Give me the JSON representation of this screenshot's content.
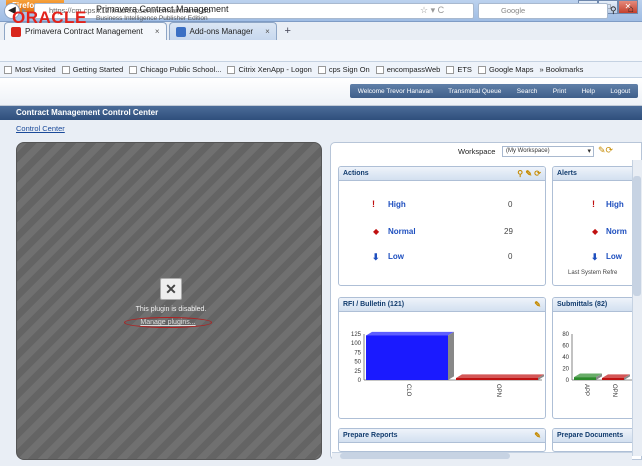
{
  "browser": {
    "menu_button": "Firefox ▾",
    "tabs": [
      {
        "label": "Primavera Contract Management"
      },
      {
        "label": "Add-ons Manager"
      }
    ],
    "url": "https://cm.cps.k12.il.us/expsonline/mainframe.do",
    "search_placeholder": "Google",
    "bookmarks": [
      "Most Visited",
      "Getting Started",
      "Chicago Public School...",
      "Citrix XenApp - Logon",
      "cps Sign On",
      "encompassWeb",
      "ETS",
      "Google Maps",
      "» Bookmarks"
    ],
    "colors": {
      "titlebar": "#bcd2ee",
      "firefox_button": "#e2700f"
    }
  },
  "oracle": {
    "logo": "ORACLE",
    "app_title": "Primavera Contract Management",
    "app_subtitle": "Business Intelligence Publisher Edition",
    "links": [
      "Welcome Trevor Hanavan",
      "Transmittal Queue",
      "Search",
      "Print",
      "Help",
      "Logout"
    ],
    "page_title": "Contract Management Control Center",
    "breadcrumb": "Control Center",
    "brand_red": "#e3221b"
  },
  "plugin": {
    "message": "This plugin is disabled.",
    "link": "Manage plugins..."
  },
  "workspace": {
    "label": "Workspace",
    "selected": "(My Workspace)"
  },
  "actions": {
    "title": "Actions",
    "rows": [
      {
        "label": "High",
        "count": "0"
      },
      {
        "label": "Normal",
        "count": "29"
      },
      {
        "label": "Low",
        "count": "0"
      }
    ]
  },
  "alerts": {
    "title": "Alerts",
    "rows": [
      {
        "label": "High"
      },
      {
        "label": "Norm"
      },
      {
        "label": "Low"
      }
    ],
    "footer": "Last System Refre"
  },
  "rfi": {
    "title": "RFI / Bulletin (121)"
  },
  "submittals": {
    "title": "Submittals (82)"
  },
  "prepare_reports": {
    "title": "Prepare Reports"
  },
  "prepare_documents": {
    "title": "Prepare Documents"
  },
  "chart_data": [
    {
      "type": "bar",
      "title": "RFI / Bulletin (121)",
      "categories": [
        "CLO",
        "OPN"
      ],
      "values": [
        121,
        0
      ],
      "colors": [
        "#1a1aff",
        "#c01010"
      ],
      "yticks": [
        "125",
        "100",
        "75",
        "50",
        "25",
        "0"
      ],
      "ylim": [
        0,
        125
      ]
    },
    {
      "type": "bar",
      "title": "Submittals (82)",
      "categories": [
        "APP",
        "OPN"
      ],
      "values": [
        5,
        0
      ],
      "colors": [
        "#2a8a2a",
        "#c01010"
      ],
      "yticks": [
        "80",
        "60",
        "40",
        "20",
        "0"
      ],
      "ylim": [
        0,
        80
      ]
    }
  ]
}
